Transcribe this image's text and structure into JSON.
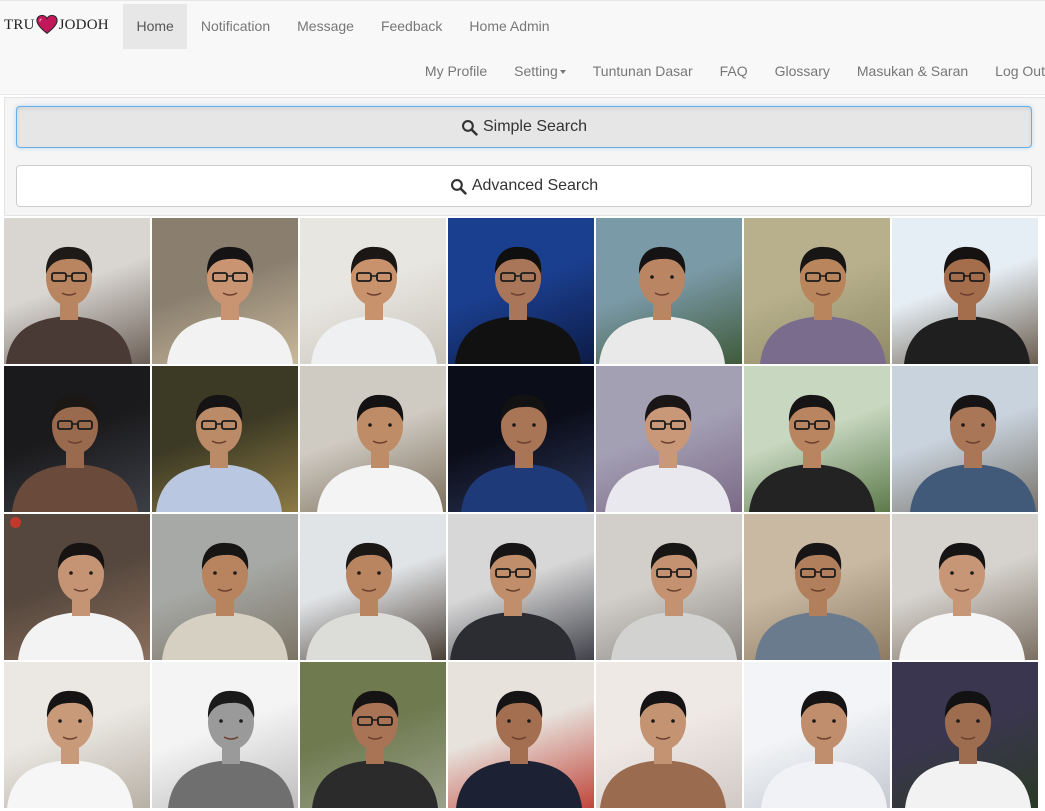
{
  "brand": {
    "left": "TRU",
    "right": "JODOH",
    "heart_icon": "heart-icon",
    "heart_color": "#c2185b"
  },
  "nav_top": [
    {
      "label": "Home",
      "active": true
    },
    {
      "label": "Notification",
      "active": false
    },
    {
      "label": "Message",
      "active": false
    },
    {
      "label": "Feedback",
      "active": false
    },
    {
      "label": "Home Admin",
      "active": false
    }
  ],
  "nav_bottom": [
    {
      "label": "My Profile",
      "dropdown": false
    },
    {
      "label": "Setting",
      "dropdown": true
    },
    {
      "label": "Tuntunan Dasar",
      "dropdown": false
    },
    {
      "label": "FAQ",
      "dropdown": false
    },
    {
      "label": "Glossary",
      "dropdown": false
    },
    {
      "label": "Masukan & Saran",
      "dropdown": false
    },
    {
      "label": "Log Out",
      "dropdown": false
    }
  ],
  "search": {
    "simple_label": "Simple Search",
    "advanced_label": "Advanced Search",
    "icon": "search-icon"
  },
  "profiles": [
    {
      "bg": "#d9d6d2",
      "bg2": "#6b5f56",
      "skin": "#b98560",
      "shirt": "#4a3a36",
      "hair": "#1d1a18",
      "glasses": true
    },
    {
      "bg": "#8a7f6f",
      "bg2": "#c9b89a",
      "skin": "#c89472",
      "shirt": "#f2f2f2",
      "hair": "#151313",
      "glasses": true
    },
    {
      "bg": "#e8e6e1",
      "bg2": "#c9c4ba",
      "skin": "#c7926c",
      "shirt": "#eef0f2",
      "hair": "#1b1715",
      "glasses": true
    },
    {
      "bg": "#1b3f8f",
      "bg2": "#0c1b46",
      "skin": "#a9765a",
      "shirt": "#111111",
      "hair": "#0f0f0f",
      "glasses": true
    },
    {
      "bg": "#7b9aa8",
      "bg2": "#3f5a3a",
      "skin": "#b98563",
      "shirt": "#e9e9ea",
      "hair": "#151313",
      "glasses": false
    },
    {
      "bg": "#b8b08c",
      "bg2": "#8f8a66",
      "skin": "#b9855c",
      "shirt": "#7a6c8c",
      "hair": "#181515",
      "glasses": true
    },
    {
      "bg": "#e6eef5",
      "bg2": "#6a5d4e",
      "skin": "#a46e4d",
      "shirt": "#1f1f1f",
      "hair": "#161212",
      "glasses": true
    },
    {
      "bg": "#1a1a1c",
      "bg2": "#3d3f47",
      "skin": "#9a6a4e",
      "shirt": "#6a4a3a",
      "hair": "#1b1715",
      "glasses": true
    },
    {
      "bg": "#3c3a24",
      "bg2": "#8d7a45",
      "skin": "#bb8a66",
      "shirt": "#b9c7e0",
      "hair": "#151313",
      "glasses": true
    },
    {
      "bg": "#cfcac2",
      "bg2": "#7c6f5c",
      "skin": "#bf8c68",
      "shirt": "#f4f4f4",
      "hair": "#141212",
      "glasses": false
    },
    {
      "bg": "#0b0d18",
      "bg2": "#2a3558",
      "skin": "#a87556",
      "shirt": "#1f3a78",
      "hair": "#121212",
      "glasses": false
    },
    {
      "bg": "#a4a0b4",
      "bg2": "#7b6a86",
      "skin": "#c99878",
      "shirt": "#e8e8ee",
      "hair": "#1a1616",
      "glasses": true
    },
    {
      "bg": "#c7d7c0",
      "bg2": "#5d7a4b",
      "skin": "#b98460",
      "shirt": "#232323",
      "hair": "#161414",
      "glasses": true
    },
    {
      "bg": "#c9d3de",
      "bg2": "#77736a",
      "skin": "#a97757",
      "shirt": "#415a7a",
      "hair": "#151313",
      "glasses": false
    },
    {
      "bg": "#55473d",
      "bg2": "#8a6f5d",
      "skin": "#c49474",
      "shirt": "#f3f3f3",
      "hair": "#161312",
      "glasses": false
    },
    {
      "bg": "#a7a9a6",
      "bg2": "#7b7465",
      "skin": "#b7845f",
      "shirt": "#d5d0c2",
      "hair": "#181515",
      "glasses": false
    },
    {
      "bg": "#e1e4e7",
      "bg2": "#4a3f36",
      "skin": "#b98460",
      "shirt": "#dcdcd8",
      "hair": "#1b1715",
      "glasses": false
    },
    {
      "bg": "#d7d7d7",
      "bg2": "#41424a",
      "skin": "#c18e6c",
      "shirt": "#2c2d33",
      "hair": "#161414",
      "glasses": true
    },
    {
      "bg": "#d2cfcb",
      "bg2": "#8a8580",
      "skin": "#c49270",
      "shirt": "#d2d3d0",
      "hair": "#181515",
      "glasses": true
    },
    {
      "bg": "#c9b9a3",
      "bg2": "#8c7b62",
      "skin": "#b27f5c",
      "shirt": "#6b7b8e",
      "hair": "#161414",
      "glasses": true
    },
    {
      "bg": "#d6d3ce",
      "bg2": "#7b6f62",
      "skin": "#c79676",
      "shirt": "#f5f5f5",
      "hair": "#151313",
      "glasses": false
    },
    {
      "bg": "#ebe8e3",
      "bg2": "#b7b0a5",
      "skin": "#c99a7a",
      "shirt": "#f6f6f6",
      "hair": "#151313",
      "glasses": false
    },
    {
      "bg": "#f4f4f4",
      "bg2": "#bdbdbd",
      "skin": "#9a9a9a",
      "shirt": "#6f6f6f",
      "hair": "#1a1a1a",
      "glasses": false
    },
    {
      "bg": "#6f7a4f",
      "bg2": "#9aa08a",
      "skin": "#a87455",
      "shirt": "#2b2b2b",
      "hair": "#151313",
      "glasses": true
    },
    {
      "bg": "#e7e2dc",
      "bg2": "#c0463b",
      "skin": "#a46f51",
      "shirt": "#1c2233",
      "hair": "#151313",
      "glasses": false
    },
    {
      "bg": "#efe9e6",
      "bg2": "#d2c9c4",
      "skin": "#c49472",
      "shirt": "#9b6b4f",
      "hair": "#151313",
      "glasses": false
    },
    {
      "bg": "#f2f4f7",
      "bg2": "#c4c8cf",
      "skin": "#c08e6c",
      "shirt": "#f0f2f5",
      "hair": "#151313",
      "glasses": false
    },
    {
      "bg": "#3b3650",
      "bg2": "#2b3a26",
      "skin": "#9e6d50",
      "shirt": "#f2f2f2",
      "hair": "#121212",
      "glasses": false
    }
  ],
  "status_dot_color": "#c0392b"
}
